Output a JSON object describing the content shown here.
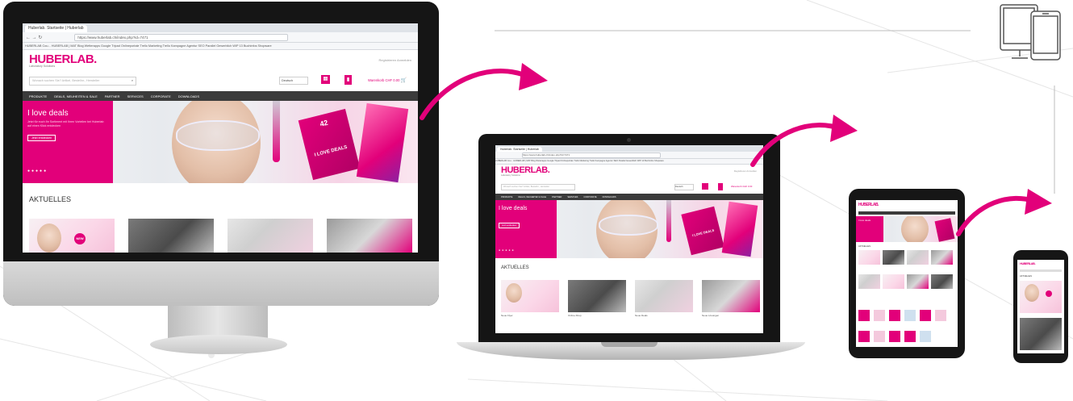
{
  "colors": {
    "brand": "#e2007a",
    "nav": "#3b3b3b",
    "bezel": "#1a1a1a"
  },
  "site": {
    "tab_title": "Huberlab. Startseite | Huberlab",
    "url": "https://www.huberlab.ch/index.php?id=7471",
    "bookmarks": "HUBERLAB Cou...  HUBERLAB | MAT  Blog  Wetterapps  Google  Tripad  Onlineportale  Trello Marketing  Trello Kampagne  Agentur  SEO Parallel  Gewerblich  WIP 13  Buchinfos  Shopware",
    "logo": "HUBERLAB.",
    "tagline": "Laboratory Solutions",
    "top_links": "Registrieren   Anmelden",
    "search_placeholder": "Wonach suchen Sie? Artikel, Bestellnr., Hersteller",
    "language": "Deutsch",
    "cart": "Warenkorb CHF 0.00",
    "nav": [
      "PRODUKTE",
      "DEALS, NEUHEITEN & SALE",
      "PARTNER",
      "SERVICES",
      "CORPORATE",
      "DOWNLOADS"
    ],
    "promo_title": "I love deals",
    "promo_text": "Jetzt für euch Ihr Sortiment mit Ihren Vorteilen bei Huberlab auf einen Klick entdecken",
    "promo_button": "Jetzt entdecken",
    "flyer_text": "I LOVE DEALS",
    "flyer_number": "42",
    "section_title": "AKTUELLES",
    "new_badge": "NEW",
    "thumb_labels": [
      "Neue Flyer",
      "Online-Shop",
      "Neue Deals",
      "Neue Lösungen"
    ]
  }
}
